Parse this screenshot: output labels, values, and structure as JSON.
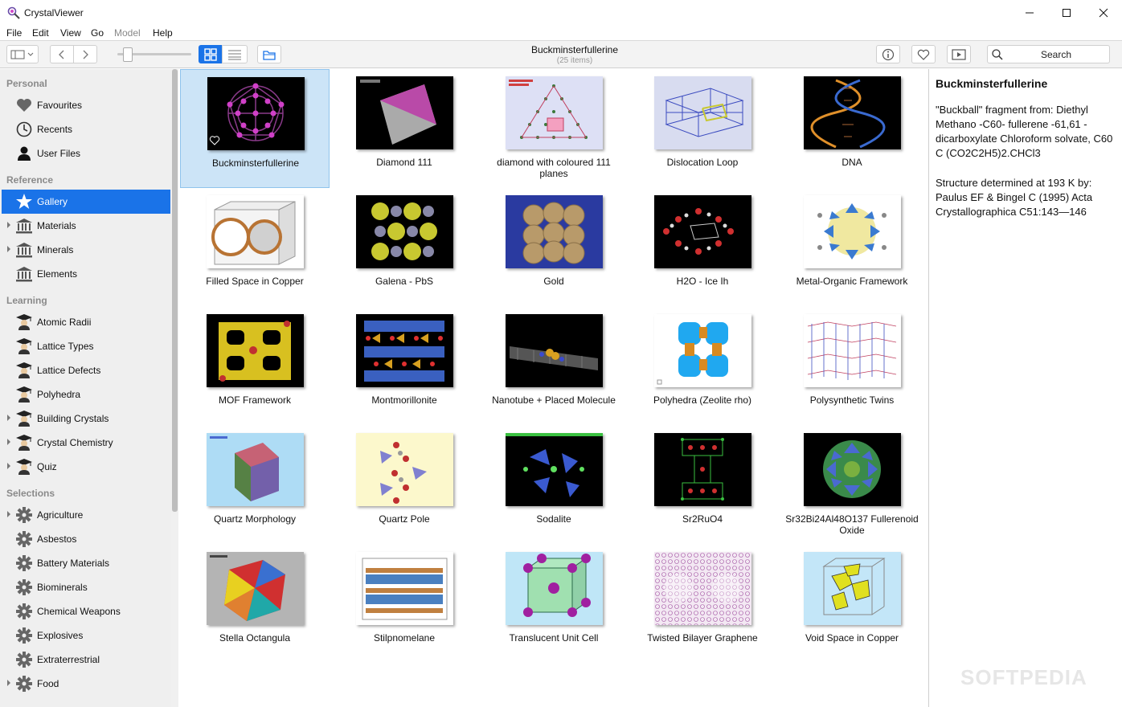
{
  "window": {
    "title": "CrystalViewer"
  },
  "menu": [
    "File",
    "Edit",
    "View",
    "Go",
    "Model",
    "Help"
  ],
  "toolbar": {
    "title": "Buckminsterfullerine",
    "subtitle": "(25 items)",
    "search_label": "Search"
  },
  "sidebar": {
    "personal_label": "Personal",
    "personal": [
      {
        "label": "Favourites",
        "icon": "heart-icon"
      },
      {
        "label": "Recents",
        "icon": "clock-icon"
      },
      {
        "label": "User Files",
        "icon": "user-icon"
      }
    ],
    "reference_label": "Reference",
    "reference": [
      {
        "label": "Gallery",
        "icon": "star-icon",
        "selected": true
      },
      {
        "label": "Materials",
        "icon": "building-icon"
      },
      {
        "label": "Minerals",
        "icon": "building-icon"
      },
      {
        "label": "Elements",
        "icon": "building-icon"
      }
    ],
    "learning_label": "Learning",
    "learning": [
      {
        "label": "Atomic Radii"
      },
      {
        "label": "Lattice Types"
      },
      {
        "label": "Lattice Defects"
      },
      {
        "label": "Polyhedra"
      },
      {
        "label": "Building Crystals"
      },
      {
        "label": "Crystal Chemistry"
      },
      {
        "label": "Quiz"
      }
    ],
    "selections_label": "Selections",
    "selections": [
      {
        "label": "Agriculture"
      },
      {
        "label": "Asbestos"
      },
      {
        "label": "Battery Materials"
      },
      {
        "label": "Biominerals"
      },
      {
        "label": "Chemical Weapons"
      },
      {
        "label": "Explosives"
      },
      {
        "label": "Extraterrestrial"
      },
      {
        "label": "Food"
      }
    ]
  },
  "gallery": [
    {
      "label": "Buckminsterfullerine",
      "bg": "#000000"
    },
    {
      "label": "Diamond 111",
      "bg": "#000000"
    },
    {
      "label": "diamond with coloured 111 planes",
      "bg": "#dde0f5"
    },
    {
      "label": "Dislocation Loop",
      "bg": "#d8dcf0"
    },
    {
      "label": "DNA",
      "bg": "#000000"
    },
    {
      "label": "Filled Space in Copper",
      "bg": "#ffffff"
    },
    {
      "label": "Galena - PbS",
      "bg": "#000000"
    },
    {
      "label": "Gold",
      "bg": "#2a3aa0"
    },
    {
      "label": "H2O - Ice Ih",
      "bg": "#000000"
    },
    {
      "label": "Metal-Organic Framework",
      "bg": "#ffffff"
    },
    {
      "label": "MOF Framework",
      "bg": "#000000"
    },
    {
      "label": "Montmorillonite",
      "bg": "#000000"
    },
    {
      "label": "Nanotube + Placed Molecule",
      "bg": "#000000"
    },
    {
      "label": "Polyhedra (Zeolite rho)",
      "bg": "#ffffff"
    },
    {
      "label": "Polysynthetic Twins",
      "bg": "#ffffff"
    },
    {
      "label": "Quartz Morphology",
      "bg": "#aedcf5"
    },
    {
      "label": "Quartz Pole",
      "bg": "#fcf8cc"
    },
    {
      "label": "Sodalite",
      "bg": "#000000"
    },
    {
      "label": "Sr2RuO4",
      "bg": "#000000"
    },
    {
      "label": "Sr32Bi24Al48O137 Fullerenoid Oxide",
      "bg": "#000000"
    },
    {
      "label": "Stella Octangula",
      "bg": "#b4b4b4"
    },
    {
      "label": "Stilpnomelane",
      "bg": "#ffffff"
    },
    {
      "label": "Translucent Unit Cell",
      "bg": "#bfe6f7"
    },
    {
      "label": "Twisted Bilayer Graphene",
      "bg": "#f3e8f3"
    },
    {
      "label": "Void Space in Copper",
      "bg": "#c3e6f8"
    }
  ],
  "info": {
    "title": "Buckminsterfullerine",
    "p1": "\"Buckball\" fragment from: Diethyl Methano -C60- fullerene -61,61 - dicarboxylate Chloroform solvate, C60 C (CO2C2H5)2.CHCl3",
    "p2": "Structure determined at 193 K by: Paulus EF & Bingel C (1995) Acta Crystallographica C51:143—146"
  },
  "watermark": "SOFTPEDIA"
}
